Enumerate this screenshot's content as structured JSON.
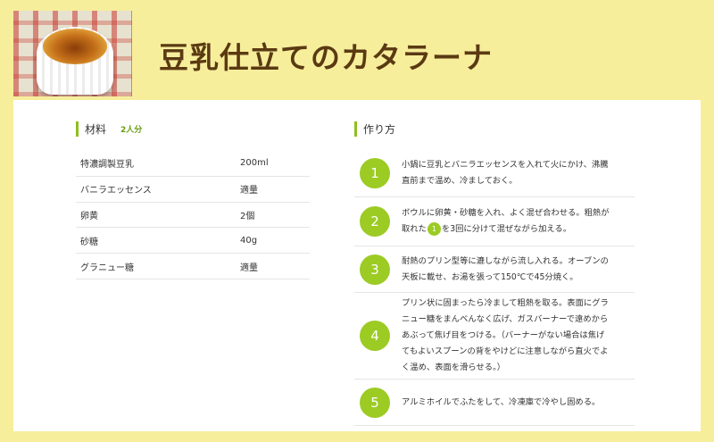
{
  "title": "豆乳仕立てのカタラーナ",
  "ingredients": {
    "heading": "材料",
    "servings": "2人分",
    "items": [
      {
        "name": "特濃調製豆乳",
        "qty": "200ml"
      },
      {
        "name": "バニラエッセンス",
        "qty": "適量"
      },
      {
        "name": "卵黄",
        "qty": "2個"
      },
      {
        "name": "砂糖",
        "qty": "40g"
      },
      {
        "name": "グラニュー糖",
        "qty": "適量"
      }
    ]
  },
  "steps": {
    "heading": "作り方",
    "items": [
      {
        "num": "1",
        "lines": [
          "小鍋に豆乳とバニラエッセンスを入れて火にかけ、沸騰",
          "直前まで温め、冷ましておく。"
        ]
      },
      {
        "num": "2",
        "line1": "ボウルに卵黄・砂糖を入れ、よく混ぜ合わせる。粗熱が",
        "line2_pre": "取れた",
        "ref": "1",
        "line2_post": "を3回に分けて混ぜながら加える。"
      },
      {
        "num": "3",
        "lines": [
          "耐熱のプリン型等に漉しながら流し入れる。オーブンの",
          "天板に載せ、お湯を張って150℃で45分焼く。"
        ]
      },
      {
        "num": "4",
        "lines": [
          "プリン状に固まったら冷まして粗熱を取る。表面にグラ",
          "ニュー糖をまんべんなく広げ、ガスバーナーで遠めから",
          "あぶって焦げ目をつける。（バーナーがない場合は焦げ",
          "てもよいスプーンの背をやけどに注意しながら直火でよ",
          "く温め、表面を滑らせる。）"
        ]
      },
      {
        "num": "5",
        "lines": [
          "アルミホイルでふたをして、冷凍庫で冷やし固める。"
        ]
      }
    ]
  },
  "colors": {
    "background": "#f7ee9c",
    "accent": "#9ccb24",
    "title": "#5a3a12"
  }
}
